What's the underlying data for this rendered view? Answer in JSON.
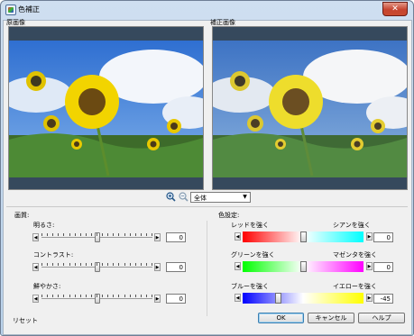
{
  "window": {
    "title": "色補正",
    "close_label": "✕"
  },
  "panes": {
    "original_label": "原画像",
    "corrected_label": "補正画像"
  },
  "icons": {
    "app": "color-correction-icon",
    "zoom_in": "zoom-in-icon",
    "zoom_out": "zoom-out-icon",
    "close": "close-icon"
  },
  "view_select": {
    "value": "全体"
  },
  "image_quality": {
    "section_label": "画質:",
    "sliders": [
      {
        "label": "明るさ:",
        "value": "0",
        "level": 0.5
      },
      {
        "label": "コントラスト:",
        "value": "0",
        "level": 0.5
      },
      {
        "label": "鮮やかさ:",
        "value": "0",
        "level": 0.5
      }
    ]
  },
  "color_settings": {
    "section_label": "色設定:",
    "sliders": [
      {
        "left_label": "レッドを強く",
        "right_label": "シアンを強く",
        "value": "0",
        "level": 0.5,
        "colors": [
          "#ff0000",
          "#ffffff",
          "#00ffff"
        ]
      },
      {
        "left_label": "グリーンを強く",
        "right_label": "マゼンタを強く",
        "value": "0",
        "level": 0.5,
        "colors": [
          "#00ff00",
          "#ffffff",
          "#ff00ff"
        ]
      },
      {
        "left_label": "ブルーを強く",
        "right_label": "イエローを強く",
        "value": "-45",
        "level": 0.28,
        "colors": [
          "#0000ff",
          "#ffffff",
          "#ffff00"
        ]
      }
    ]
  },
  "footer": {
    "reset_label": "リセット",
    "ok_label": "OK",
    "cancel_label": "キャンセル",
    "help_label": "ヘルプ"
  }
}
